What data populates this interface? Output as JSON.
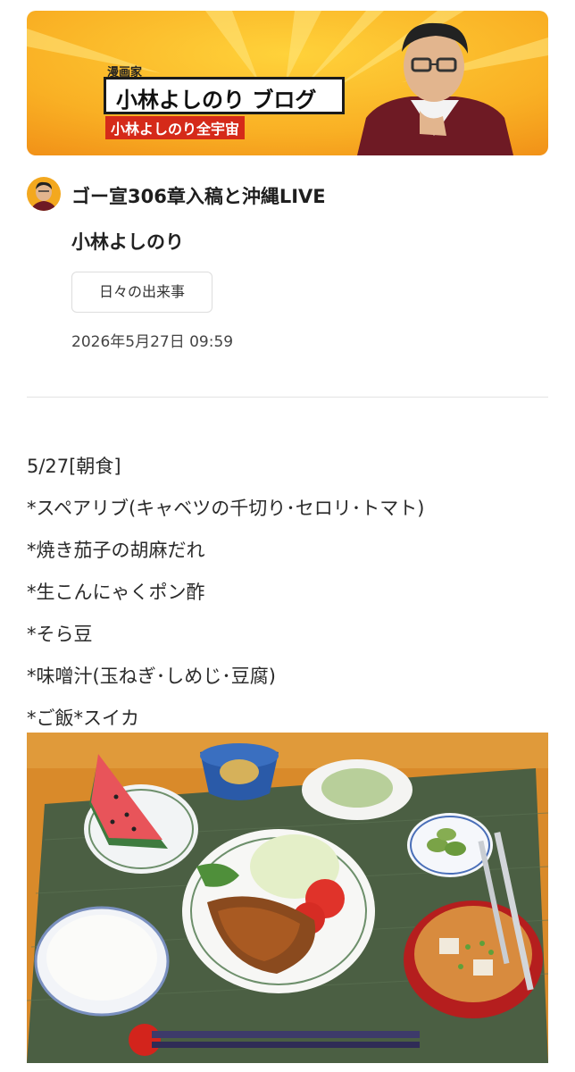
{
  "banner": {
    "label": "漫画家",
    "title": "小林よしのり ブログ",
    "subtitle": "小林よしのり全宇宙"
  },
  "post": {
    "title": "ゴー宣306章入稿と沖縄LIVE",
    "author": "小林よしのり",
    "category": "日々の出来事",
    "date": "2026年5月27日 09:59"
  },
  "body": {
    "lines": [
      "5/27[朝食]",
      "*スペアリブ(キャベツの千切り･セロリ･トマト)",
      "*焼き茄子の胡麻だれ",
      "*生こんにゃくポン酢",
      "*そら豆",
      "*味噌汁(玉ねぎ･しめじ･豆腐)",
      "*ご飯*スイカ"
    ]
  },
  "colors": {
    "banner_orange": "#f6a41c",
    "banner_red": "#d52a19",
    "table_wood": "#d98a2a",
    "mat_green": "#4b5f43"
  }
}
